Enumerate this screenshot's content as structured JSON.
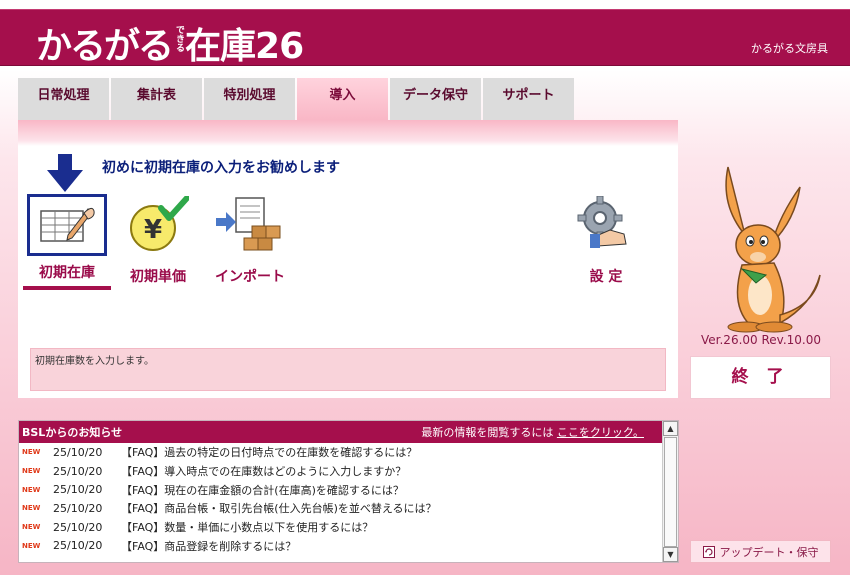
{
  "app": {
    "logo_main": "かるがる",
    "logo_small": "できる",
    "logo_product": "在庫26",
    "brand": "かるがる文房具"
  },
  "tabs": [
    {
      "label": "日常処理",
      "active": false
    },
    {
      "label": "集計表",
      "active": false
    },
    {
      "label": "特別処理",
      "active": false
    },
    {
      "label": "導入",
      "active": true
    },
    {
      "label": "データ保守",
      "active": false
    },
    {
      "label": "サポート",
      "active": false
    }
  ],
  "main": {
    "intro": "初めに初期在庫の入力をお勧めします",
    "functions": [
      {
        "label": "初期在庫",
        "icon": "ledger-edit-icon",
        "selected": true
      },
      {
        "label": "初期単価",
        "icon": "yen-check-icon",
        "selected": false
      },
      {
        "label": "インポート",
        "icon": "import-boxes-icon",
        "selected": false
      },
      {
        "label": "設 定",
        "icon": "settings-gear-icon",
        "selected": false
      }
    ],
    "description": "初期在庫数を入力します。"
  },
  "side": {
    "mascot": "kangaroo-mascot",
    "version": "Ver.26.00 Rev.10.00",
    "exit_label": "終 了",
    "update_label": "アップデート・保守"
  },
  "news": {
    "title": "BSLからのお知らせ",
    "link_prefix": "最新の情報を閲覧するには",
    "link_text": "ここをクリック。",
    "badge": "NEW",
    "items": [
      {
        "date": "25/10/20",
        "text": "【FAQ】過去の特定の日付時点での在庫数を確認するには？"
      },
      {
        "date": "25/10/20",
        "text": "【FAQ】導入時点での在庫数はどのように入力しますか？"
      },
      {
        "date": "25/10/20",
        "text": "【FAQ】現在の在庫金額の合計(在庫高)を確認するには？"
      },
      {
        "date": "25/10/20",
        "text": "【FAQ】商品台帳・取引先台帳(仕入先台帳)を並べ替えるには？"
      },
      {
        "date": "25/10/20",
        "text": "【FAQ】数量・単価に小数点以下を使用するには？"
      },
      {
        "date": "25/10/20",
        "text": "【FAQ】商品登録を削除するには？"
      }
    ]
  },
  "colors": {
    "brand": "#a50f4c",
    "accent_blue": "#1a2d8f",
    "link_blue": "#0b1f7a"
  }
}
